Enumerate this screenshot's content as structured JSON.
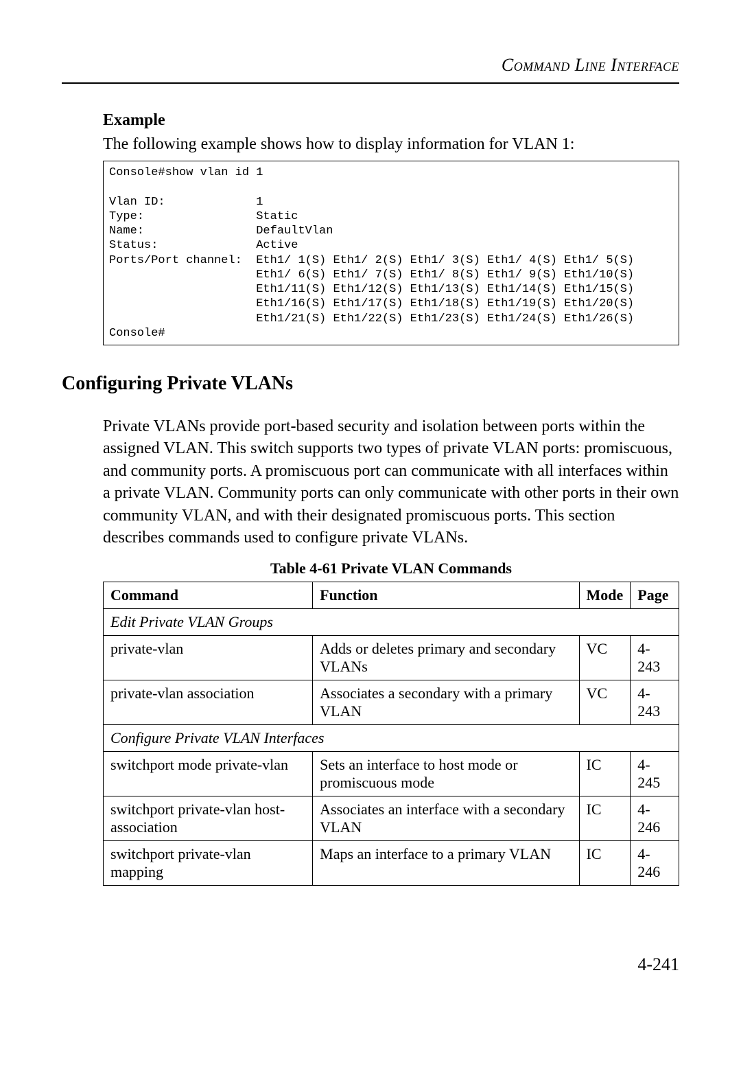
{
  "runningHead": "Command Line Interface",
  "example": {
    "heading": "Example",
    "lead": "The following example shows how to display information for VLAN 1:",
    "code": "Console#show vlan id 1\n\nVlan ID:             1\nType:                Static\nName:                DefaultVlan\nStatus:              Active\nPorts/Port channel:  Eth1/ 1(S) Eth1/ 2(S) Eth1/ 3(S) Eth1/ 4(S) Eth1/ 5(S)\n                     Eth1/ 6(S) Eth1/ 7(S) Eth1/ 8(S) Eth1/ 9(S) Eth1/10(S)\n                     Eth1/11(S) Eth1/12(S) Eth1/13(S) Eth1/14(S) Eth1/15(S)\n                     Eth1/16(S) Eth1/17(S) Eth1/18(S) Eth1/19(S) Eth1/20(S)\n                     Eth1/21(S) Eth1/22(S) Eth1/23(S) Eth1/24(S) Eth1/26(S)\nConsole#"
  },
  "section": {
    "title": "Configuring Private VLANs",
    "body": "Private VLANs provide port-based security and isolation between ports within the assigned VLAN. This switch supports two types of private VLAN ports: promiscuous, and community ports. A promiscuous port can communicate with all interfaces within a private VLAN. Community ports can only communicate with other ports in their own community VLAN, and with their designated promiscuous ports. This section describes commands used to configure private VLANs."
  },
  "table": {
    "title": "Table 4-61  Private VLAN Commands",
    "headers": {
      "c1": "Command",
      "c2": "Function",
      "c3": "Mode",
      "c4": "Page"
    },
    "group1": "Edit Private VLAN Groups",
    "rows1": [
      {
        "c1": "private-vlan",
        "c2": "Adds or deletes primary and secondary VLANs",
        "c3": "VC",
        "c4": "4-243"
      },
      {
        "c1": "private-vlan association",
        "c2": "Associates a secondary with a primary VLAN",
        "c3": "VC",
        "c4": "4-243"
      }
    ],
    "group2": "Configure Private VLAN Interfaces",
    "rows2": [
      {
        "c1": "switchport mode private-vlan",
        "c2": "Sets an interface to host mode or promiscuous mode",
        "c3": "IC",
        "c4": "4-245"
      },
      {
        "c1": "switchport private-vlan host-association",
        "c2": "Associates an interface with a secondary VLAN",
        "c3": "IC",
        "c4": "4-246"
      },
      {
        "c1": "switchport private-vlan mapping",
        "c2": "Maps an interface to a primary VLAN",
        "c3": "IC",
        "c4": "4-246"
      }
    ]
  },
  "pageNumber": "4-241"
}
